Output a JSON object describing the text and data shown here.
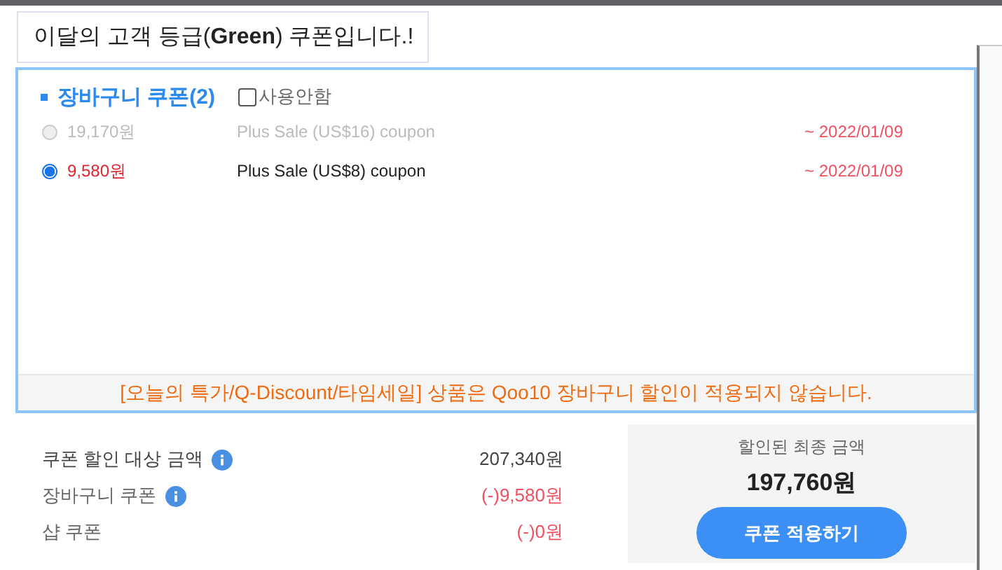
{
  "header": {
    "title": "이달의 고객 등급(**Green**) 쿠폰입니다.!"
  },
  "cart_coupons": {
    "title": "장바구니 쿠폰(2)",
    "no_use": {
      "label": "사용안함",
      "checked": false
    },
    "coupons": [
      {
        "amount": "19,170원",
        "name": "Plus Sale (US$16) coupon",
        "expiry": "~ 2022/01/09",
        "selected": false,
        "disabled": true
      },
      {
        "amount": "9,580원",
        "name": "Plus Sale (US$8) coupon",
        "expiry": "~ 2022/01/09",
        "selected": true,
        "disabled": false
      }
    ],
    "notice": "[오늘의 특가/Q-Discount/타임세일] 상품은 Qoo10 장바구니 할인이 적용되지 않습니다."
  },
  "summary": [
    {
      "label": "쿠폰 할인 대상 금액",
      "info": true,
      "value": "207,340원",
      "kind": "total"
    },
    {
      "label": "장바구니 쿠폰",
      "info": true,
      "value": "(-)9,580원",
      "kind": "discount"
    },
    {
      "label": "샵 쿠폰",
      "info": false,
      "value": "(-)0원",
      "kind": "discount"
    }
  ],
  "final": {
    "label": "할인된 최종 금액",
    "amount": "197,760원",
    "button": "쿠폰 적용하기"
  }
}
